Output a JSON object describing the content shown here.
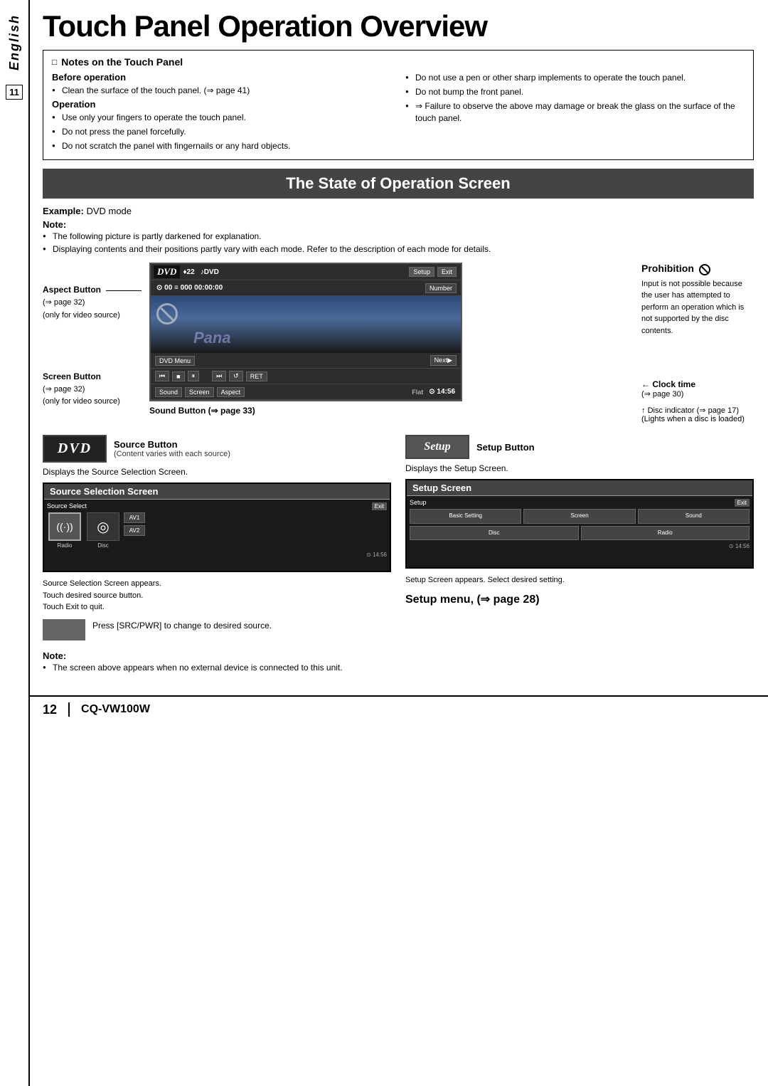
{
  "page": {
    "title": "Touch Panel Operation Overview",
    "lang_label": "English",
    "page_number": "11"
  },
  "notes_section": {
    "heading": "Notes on the Touch Panel",
    "before_operation_label": "Before operation",
    "before_operation_items": [
      "Clean the surface of the touch panel.  (⇒ page 41)"
    ],
    "operation_label": "Operation",
    "operation_items": [
      "Use only your fingers to operate the touch panel.",
      "Do not press the panel forcefully.",
      "Do not scratch the panel with fingernails or any hard objects."
    ],
    "right_items": [
      "Do not use a pen or other sharp implements to operate the touch panel.",
      "Do not bump the front panel.",
      "⇒ Failure to observe the above may damage or break the glass on the surface of the touch panel."
    ]
  },
  "state_section": {
    "heading": "The State of Operation Screen",
    "example_label": "Example:",
    "example_value": "DVD mode",
    "note_label": "Note:",
    "note_items": [
      "The following picture is partly darkened for explanation.",
      "Displaying contents and their positions partly vary with each mode. Refer to the description of each mode for details."
    ]
  },
  "screen_labels": {
    "aspect_button": "Aspect Button",
    "aspect_page": "(⇒ page 32)",
    "aspect_note": "(only for video source)",
    "screen_button": "Screen Button",
    "screen_page": "(⇒ page 32)",
    "screen_note": "(only for video source)",
    "sound_button": "Sound Button (⇒ page 33)"
  },
  "dvd_ui": {
    "source_label": "DVD",
    "vol_label": "♦22",
    "mode_label": "♪DVD",
    "setup_btn": "Setup",
    "exit_btn": "Exit",
    "time_display": "⊙ 00  ≡ 000  00:00:00",
    "number_btn": "Number",
    "menu_btn": "DVD Menu",
    "prev_btn": "⏮",
    "stop_btn": "■",
    "pause_btn": "⏸",
    "ff_btn": "⏭",
    "rotate_btn": "↺",
    "ret_btn": "RET",
    "next_btn": "Next▶",
    "sound_btn": "Sound",
    "screen_btn": "Screen",
    "aspect_btn": "Aspect",
    "flat_label": "Flat",
    "clock_label": "⊙ 14:56"
  },
  "prohibition": {
    "title": "Prohibition",
    "text": "Input is not possible because the user has attempted to perform an operation which is not supported by the disc contents."
  },
  "clock_info": {
    "label": "Clock time",
    "page": "(⇒ page 30)"
  },
  "disc_info": {
    "label": "Disc indicator (⇒ page 17)",
    "sub": "(Lights when a disc is loaded)"
  },
  "source_button_section": {
    "logo": "DVD",
    "button_label": "Source Button",
    "button_sub": "(Content varies with each source)",
    "displays_text": "Displays the Source Selection Screen."
  },
  "setup_button_section": {
    "logo": "Setup",
    "button_label": "Setup Button",
    "displays_text": "Displays the Setup Screen."
  },
  "source_selection_screen": {
    "header": "Source Selection Screen",
    "screen_label": "Source Select",
    "exit_btn": "Exit",
    "icons": [
      {
        "symbol": "((·))",
        "label": "Radio"
      },
      {
        "symbol": "◎",
        "label": "Disc"
      }
    ],
    "av_buttons": [
      "AV1",
      "AV2"
    ],
    "time": "⊙ 14:56",
    "appears_text": "Source Selection Screen appears.\nTouch desired source button.\nTouch Exit to quit."
  },
  "setup_screen": {
    "header": "Setup Screen",
    "screen_label": "Setup",
    "exit_btn": "Exit",
    "buttons_row1": [
      "Basic Setting",
      "Screen",
      "Sound"
    ],
    "buttons_row2": [
      "Disc",
      "Radio"
    ],
    "time": "⊙ 14:56",
    "appears_text": "Setup Screen appears. Select desired setting.",
    "menu_text": "Setup menu, (⇒ page 28)"
  },
  "press_src": {
    "text": "Press [SRC/PWR] to change to desired source."
  },
  "bottom_note": {
    "label": "Note:",
    "items": [
      "The screen above appears when no external device is connected to this unit."
    ]
  },
  "footer": {
    "page_number": "12",
    "model": "CQ-VW100W",
    "separator": "|"
  }
}
